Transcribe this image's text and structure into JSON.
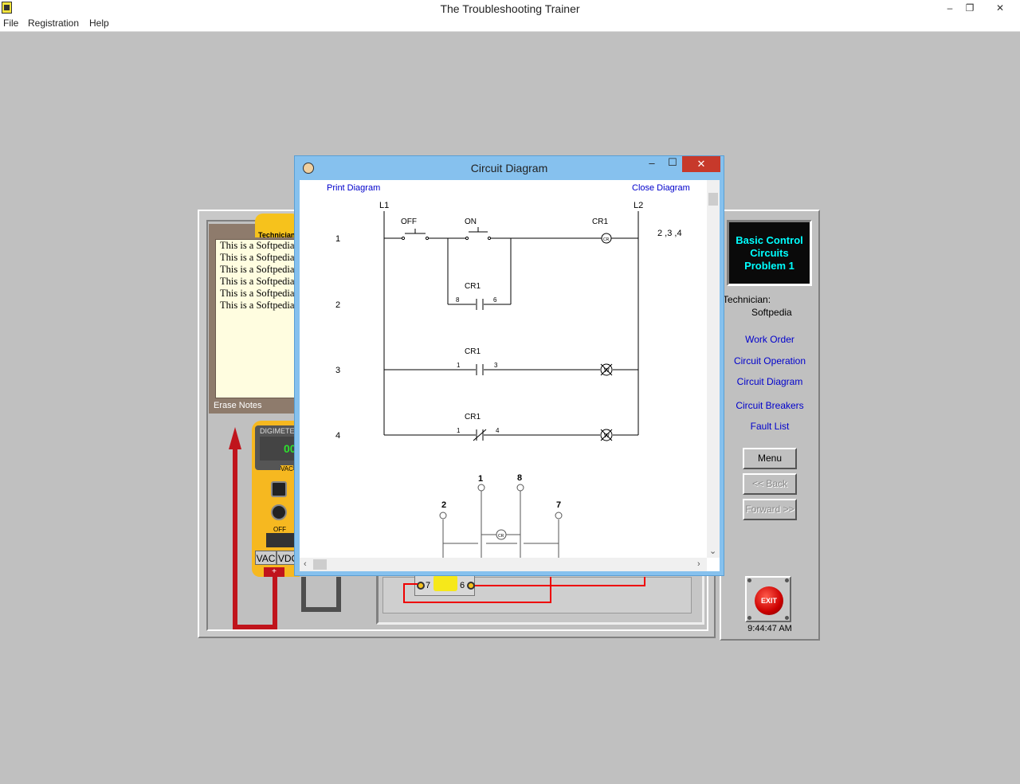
{
  "app": {
    "title": "The Troubleshooting Trainer",
    "window_controls": {
      "minimize": "–",
      "restore": "❐",
      "close": "✕"
    }
  },
  "menu": [
    "File",
    "Registration",
    "Help"
  ],
  "notes": {
    "tab_label": "Technician",
    "lines": [
      "This is a Softpedia test",
      "This is a Softpedia test",
      "This is a Softpedia test",
      "This is a Softpedia test",
      "This is a Softpedia test",
      "This is a Softpedia test"
    ],
    "erase_label": "Erase Notes"
  },
  "meter": {
    "brand": "DIGIMETER",
    "reading": "00",
    "mode_mini": "VAC",
    "off_label": "OFF",
    "range_vac": "VAC",
    "range_vdc": "VDC",
    "plus_jack": "+"
  },
  "board": {
    "terminal_left": "7",
    "terminal_right": "6"
  },
  "problem": {
    "line1": "Basic Control",
    "line2": "Circuits",
    "line3": "Problem 1"
  },
  "technician": {
    "label": "Technician:",
    "name": "Softpedia"
  },
  "nav": {
    "links": [
      "Work Order",
      "Circuit Operation",
      "Circuit Diagram",
      "Circuit Breakers",
      "Fault List"
    ],
    "menu_button": "Menu",
    "back_button": "<< Back",
    "forward_button": "Forward >>",
    "exit_button": "EXIT",
    "clock": "9:44:47 AM"
  },
  "dialog": {
    "title": "Circuit Diagram",
    "print_link": "Print Diagram",
    "close_link": "Close Diagram",
    "controls": {
      "minimize": "–",
      "maximize": "☐",
      "close": "✕"
    },
    "diagram": {
      "l1": "L1",
      "l2": "L2",
      "rungs": [
        "1",
        "2",
        "3",
        "4"
      ],
      "off_label": "OFF",
      "on_label": "ON",
      "cr1": "CR1",
      "coil_contacts": "2 ,3 ,4",
      "contact_nums": {
        "r2_left": "8",
        "r2_right": "6",
        "r3_left": "1",
        "r3_right": "3",
        "r4_left": "1",
        "r4_right": "4"
      },
      "pins": {
        "p1": "1",
        "p8": "8",
        "p2": "2",
        "p7": "7"
      },
      "coil_text": "CR",
      "lamp_text": "W",
      "relay_center": "CR"
    }
  },
  "colors": {
    "accent_cyan": "#00ffff",
    "exit_red": "#cc0000",
    "link_blue": "#0000cc",
    "dialog_frame": "#86c1ee"
  }
}
